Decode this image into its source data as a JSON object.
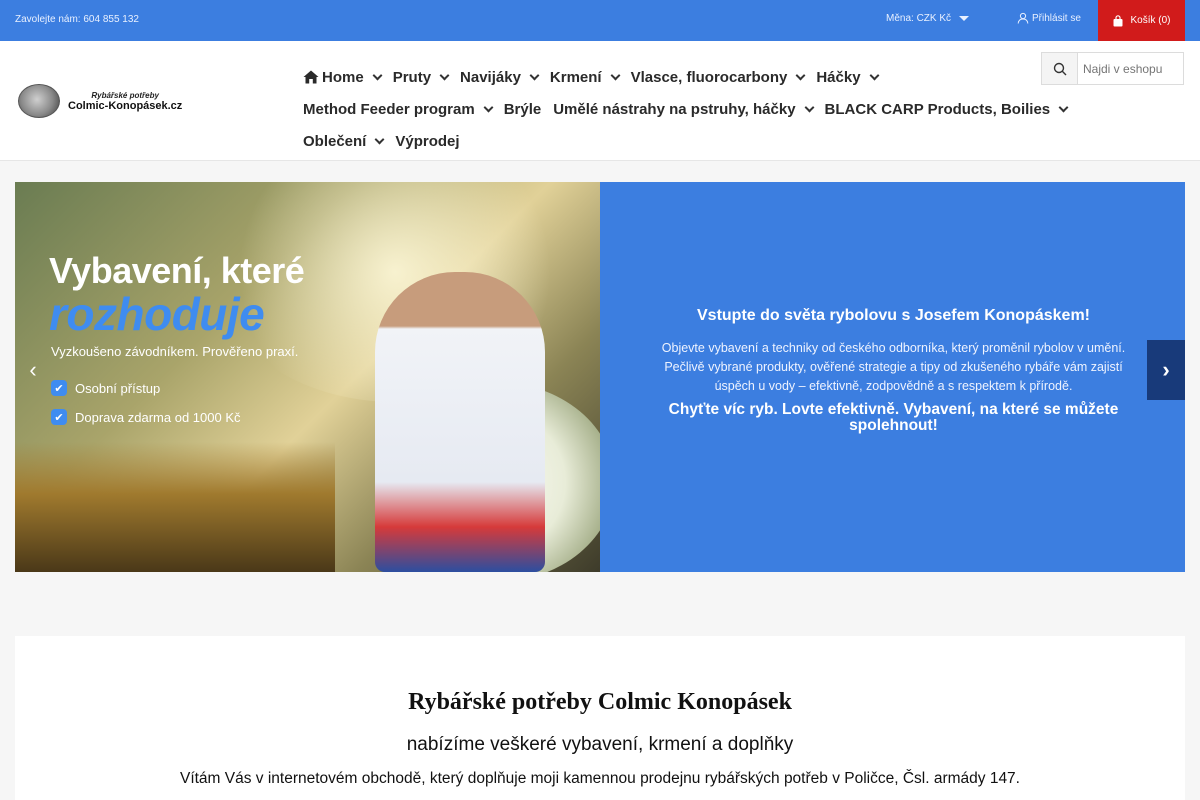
{
  "topbar": {
    "contact": "Zavolejte nám: 604 855 132",
    "currency": "Měna: CZK Kč",
    "login": "Přihlásit se",
    "cart": "Košík (0)"
  },
  "logo": {
    "line1": "Rybářské potřeby",
    "line2": "Colmic-Konopásek.cz"
  },
  "nav": {
    "items": [
      {
        "label": "Home"
      },
      {
        "label": "Pruty"
      },
      {
        "label": "Navijáky"
      },
      {
        "label": "Krmení"
      },
      {
        "label": "Vlasce, fluorocarbony"
      },
      {
        "label": "Háčky"
      },
      {
        "label": "Method Feeder program"
      },
      {
        "label": "Brýle"
      },
      {
        "label": "Umělé nástrahy na pstruhy, háčky"
      },
      {
        "label": "BLACK CARP Products, Boilies"
      },
      {
        "label": "Oblečení"
      },
      {
        "label": "Výprodej"
      }
    ]
  },
  "search": {
    "placeholder": "Najdi v eshopu"
  },
  "carousel": {
    "image_headline_1": "Vybavení, které",
    "image_headline_2": "rozhoduje",
    "image_sub": "Vyzkoušeno závodníkem. Prověřeno praxí.",
    "image_bullets": [
      "Osobní přístup",
      "Doprava zdarma od 1000 Kč"
    ],
    "title": "Vstupte do světa rybolovu s Josefem Konopáskem!",
    "text": "Objevte vybavení a techniky od českého odborníka, který proměnil rybolov v umění. Pečlivě vybrané produkty, ověřené strategie a tipy od zkušeného rybáře vám zajistí úspěch u vody – efektivně, zodpovědně a s respektem k přírodě.",
    "cta": "Chyťte víc ryb. Lovte efektivně. Vybavení, na které se můžete spolehnout!",
    "prev": "‹",
    "next": "›"
  },
  "intro": {
    "title": "Rybářské potřeby Colmic Konopásek",
    "subtitle": "nabízíme veškeré vybavení, krmení a doplňky",
    "text": "Vítám Vás v internetovém obchodě, který doplňuje moji kamennou prodejnu rybářských potřeb v Poličce, Čsl. armády 147."
  }
}
